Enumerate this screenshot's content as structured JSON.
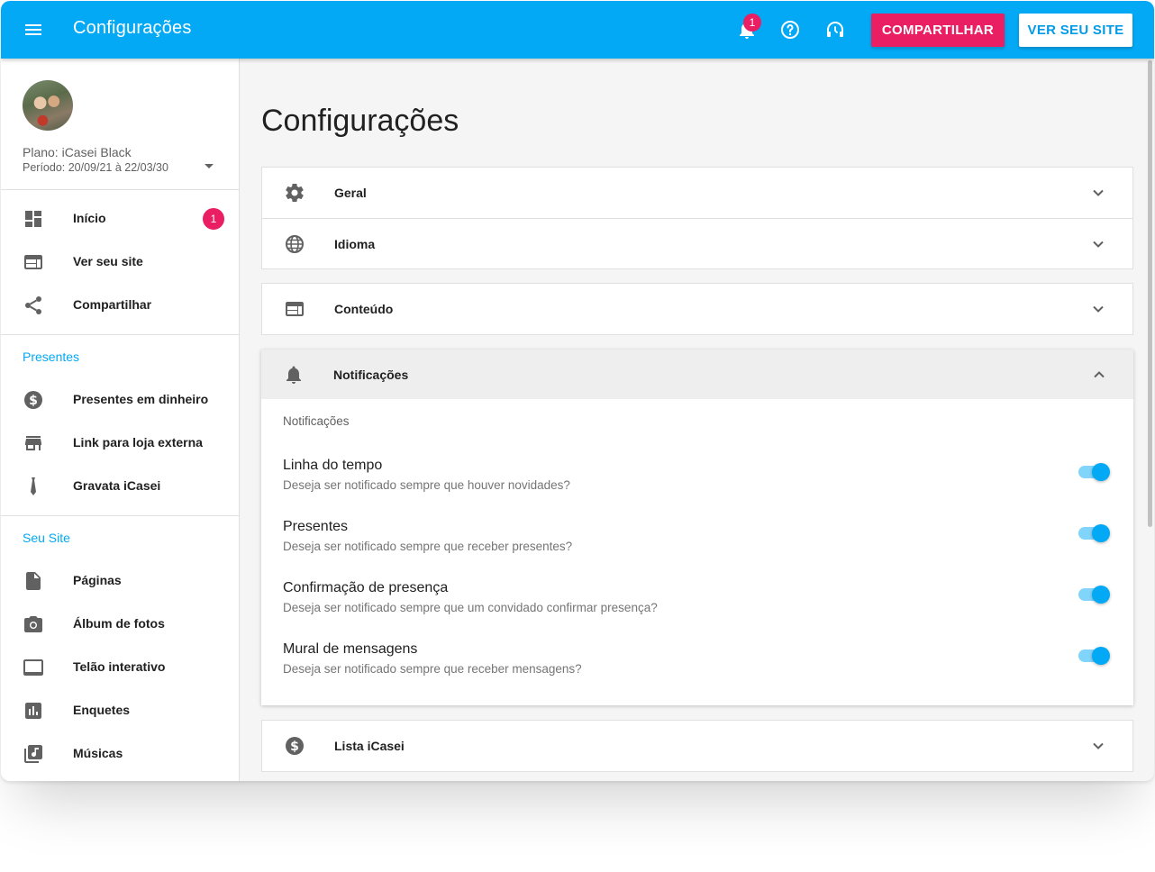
{
  "appbar": {
    "title": "Configurações",
    "notification_count": "1",
    "share_label": "COMPARTILHAR",
    "site_label": "VER SEU SITE"
  },
  "sidebar": {
    "plan": "Plano: iCasei Black",
    "period": "Período: 20/09/21 à 22/03/30",
    "main_items": [
      {
        "label": "Início",
        "icon": "dashboard-icon",
        "badge": "1"
      },
      {
        "label": "Ver seu site",
        "icon": "web-icon"
      },
      {
        "label": "Compartilhar",
        "icon": "share-icon"
      }
    ],
    "presents_title": "Presentes",
    "presents_items": [
      {
        "label": "Presentes em dinheiro",
        "icon": "money-icon"
      },
      {
        "label": "Link para loja externa",
        "icon": "store-icon"
      },
      {
        "label": "Gravata iCasei",
        "icon": "tie-icon"
      }
    ],
    "site_title": "Seu Site",
    "site_items": [
      {
        "label": "Páginas",
        "icon": "page-icon"
      },
      {
        "label": "Álbum de fotos",
        "icon": "camera-icon"
      },
      {
        "label": "Telão interativo",
        "icon": "screen-icon"
      },
      {
        "label": "Enquetes",
        "icon": "poll-icon"
      },
      {
        "label": "Músicas",
        "icon": "music-icon"
      }
    ]
  },
  "main": {
    "page_title": "Configurações",
    "panels": {
      "geral": "Geral",
      "idioma": "Idioma",
      "conteudo": "Conteúdo",
      "lista": "Lista iCasei"
    },
    "notifications": {
      "title": "Notificações",
      "subtitle": "Notificações",
      "options": [
        {
          "title": "Linha do tempo",
          "desc": "Deseja ser notificado sempre que houver novidades?",
          "enabled": true
        },
        {
          "title": "Presentes",
          "desc": "Deseja ser notificado sempre que receber presentes?",
          "enabled": true
        },
        {
          "title": "Confirmação de presença",
          "desc": "Deseja ser notificado sempre que um convidado confirmar presença?",
          "enabled": true
        },
        {
          "title": "Mural de mensagens",
          "desc": "Deseja ser notificado sempre que receber mensagens?",
          "enabled": true
        }
      ]
    }
  },
  "colors": {
    "primary": "#03a9f4",
    "accent": "#e91e63"
  }
}
